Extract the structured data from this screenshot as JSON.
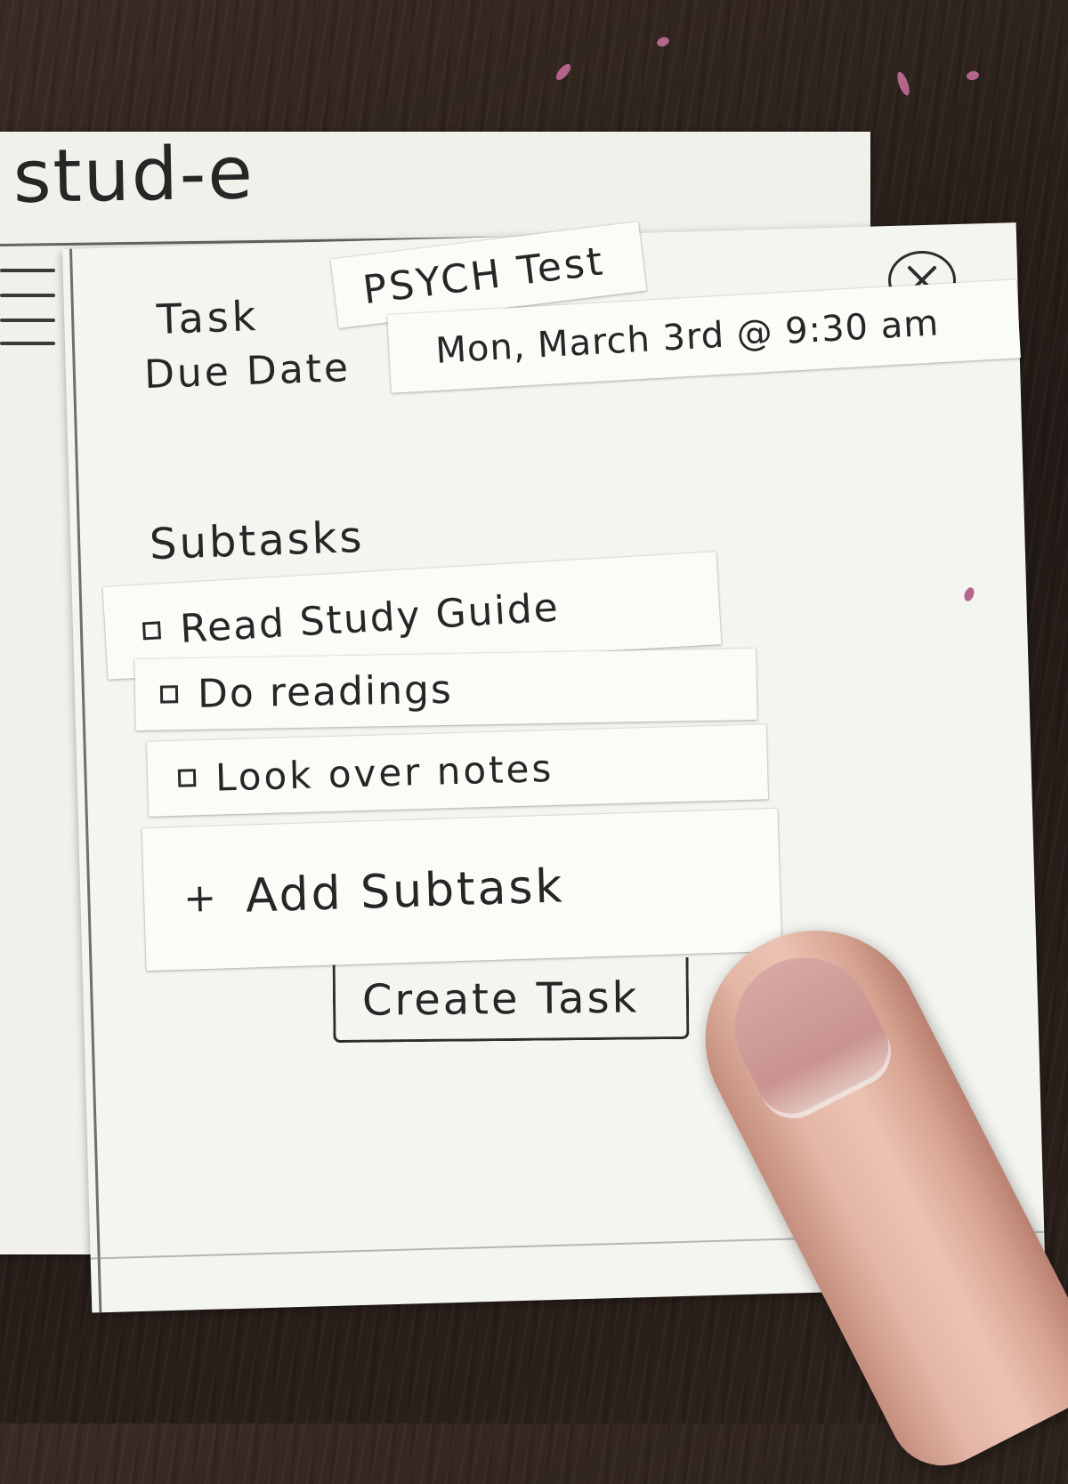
{
  "app": {
    "title": "stud-e"
  },
  "sidebar": {
    "menu_icon": "hamburger-menu-icon"
  },
  "modal": {
    "close_icon": "close-x-icon",
    "task_label": "Task",
    "task_name": "PSYCH Test",
    "due_label": "Due Date",
    "due_value": "Mon, March 3rd @ 9:30 am",
    "subtasks_label": "Subtasks",
    "subtasks": [
      {
        "label": "Read Study Guide",
        "checked": false
      },
      {
        "label": "Do readings",
        "checked": false
      },
      {
        "label": "Look over notes",
        "checked": false
      }
    ],
    "add_subtask_label": "Add Subtask",
    "create_task_label": "Create Task"
  },
  "colors": {
    "paper": "#f4f4f0",
    "ink": "#262626",
    "table": "#2a201b"
  }
}
